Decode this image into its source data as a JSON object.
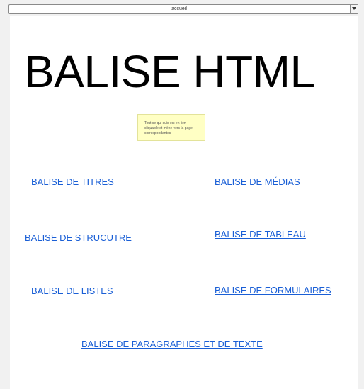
{
  "select": {
    "value": "accueil"
  },
  "page": {
    "title": "BALISE HTML",
    "note": "Tout ce qui suis est en lien cliquable et mène vers la page correspondantes"
  },
  "links": {
    "titres": "BALISE DE TITRES",
    "medias": "BALISE DE MÉDIAS",
    "structure": "BALISE DE STRUCUTRE",
    "tableau": "BALISE DE TABLEAU",
    "listes": "BALISE DE LISTES",
    "formulaires": "BALISE DE FORMULAIRES",
    "paragraphes": "BALISE DE PARAGRAPHES ET DE TEXTE"
  },
  "colors": {
    "link": "#1a5fd6",
    "note_background": "#ffffc4",
    "page_background": "#ffffff",
    "outer_background": "#f1f1f1"
  },
  "icons": {
    "select_arrow": "chevron-down-icon"
  }
}
